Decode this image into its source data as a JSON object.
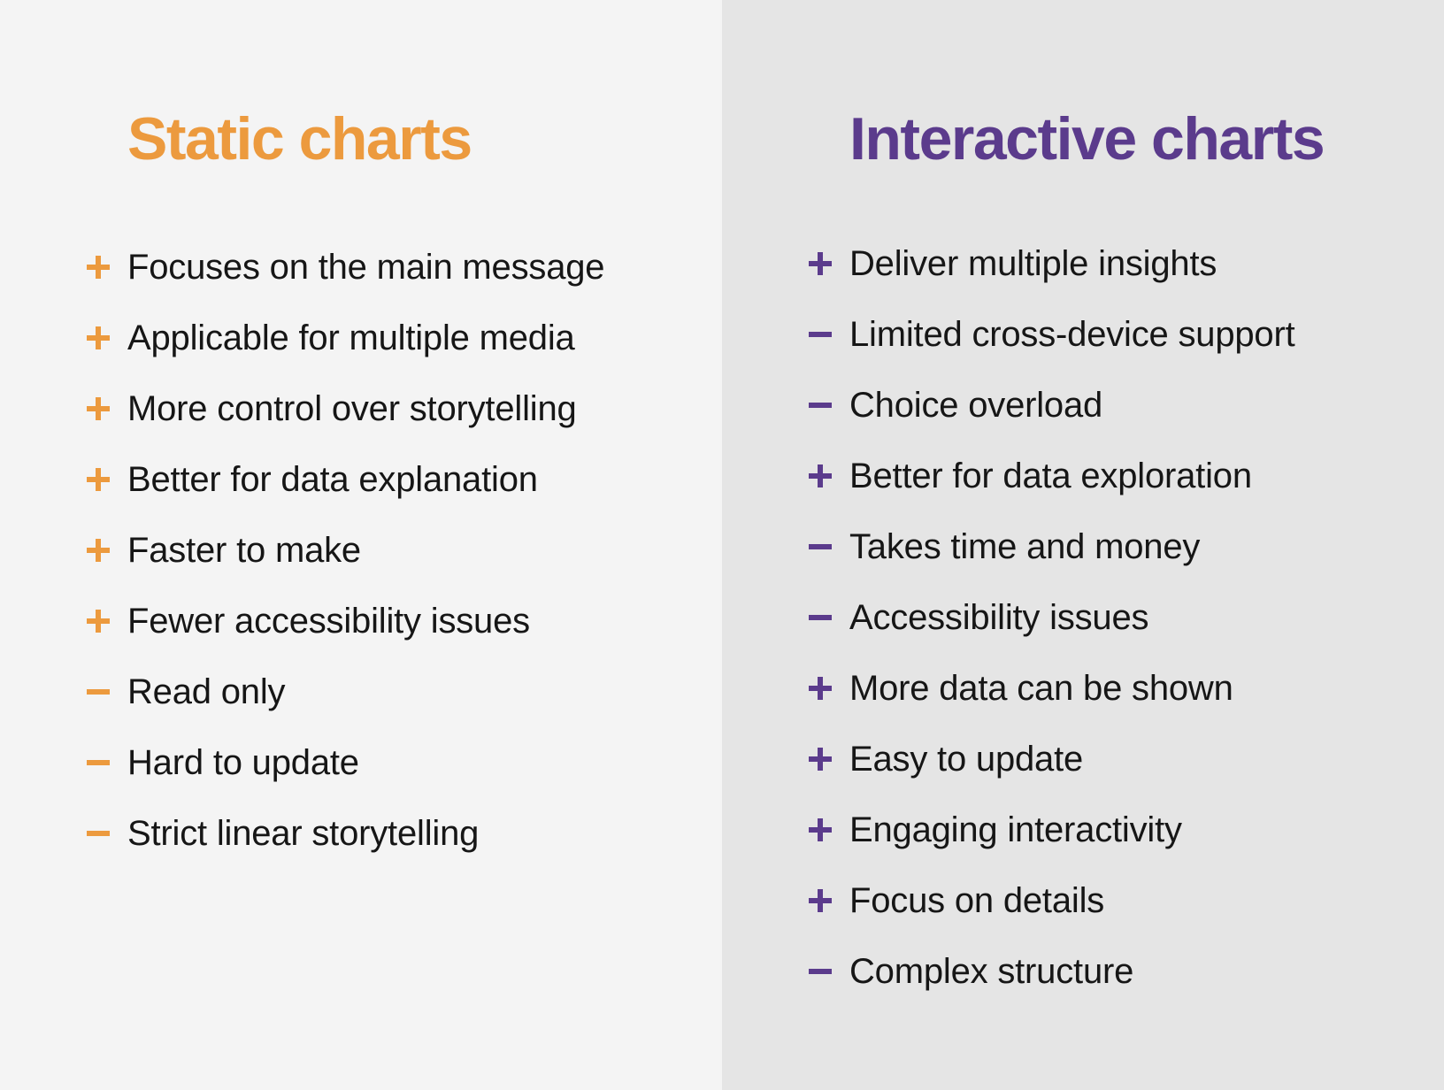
{
  "colors": {
    "static_accent": "#ec9a3e",
    "interactive_accent": "#5b3b8c",
    "left_bg": "#f4f4f4",
    "right_bg": "#e5e5e5",
    "text": "#161616"
  },
  "static": {
    "title": "Static charts",
    "items": [
      {
        "sign": "plus",
        "icon": "plus-icon",
        "text": "Focuses on the main message"
      },
      {
        "sign": "plus",
        "icon": "plus-icon",
        "text": "Applicable for multiple media"
      },
      {
        "sign": "plus",
        "icon": "plus-icon",
        "text": "More control over storytelling"
      },
      {
        "sign": "plus",
        "icon": "plus-icon",
        "text": "Better for data explanation"
      },
      {
        "sign": "plus",
        "icon": "plus-icon",
        "text": "Faster to make"
      },
      {
        "sign": "plus",
        "icon": "plus-icon",
        "text": "Fewer accessibility issues"
      },
      {
        "sign": "minus",
        "icon": "minus-icon",
        "text": "Read only"
      },
      {
        "sign": "minus",
        "icon": "minus-icon",
        "text": "Hard to update"
      },
      {
        "sign": "minus",
        "icon": "minus-icon",
        "text": "Strict linear storytelling"
      }
    ]
  },
  "interactive": {
    "title": "Interactive charts",
    "items": [
      {
        "sign": "plus",
        "icon": "plus-icon",
        "text": "Deliver multiple insights"
      },
      {
        "sign": "minus",
        "icon": "minus-icon",
        "text": "Limited cross-device support"
      },
      {
        "sign": "minus",
        "icon": "minus-icon",
        "text": "Choice overload"
      },
      {
        "sign": "plus",
        "icon": "plus-icon",
        "text": "Better for data exploration"
      },
      {
        "sign": "minus",
        "icon": "minus-icon",
        "text": "Takes time and money"
      },
      {
        "sign": "minus",
        "icon": "minus-icon",
        "text": "Accessibility issues"
      },
      {
        "sign": "plus",
        "icon": "plus-icon",
        "text": "More data can be shown"
      },
      {
        "sign": "plus",
        "icon": "plus-icon",
        "text": "Easy to update"
      },
      {
        "sign": "plus",
        "icon": "plus-icon",
        "text": "Engaging interactivity"
      },
      {
        "sign": "plus",
        "icon": "plus-icon",
        "text": "Focus on details"
      },
      {
        "sign": "minus",
        "icon": "minus-icon",
        "text": "Complex structure"
      }
    ]
  }
}
